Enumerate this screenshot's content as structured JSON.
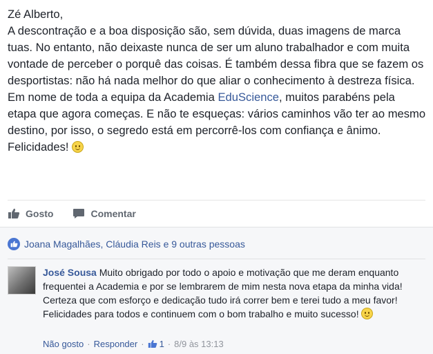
{
  "post": {
    "greeting": "Zé Alberto,",
    "paragraph1": "A descontração e a boa disposição são, sem dúvida, duas imagens de marca tuas. No entanto, não deixaste nunca de ser um aluno trabalhador e com muita vontade de perceber o porquê das coisas. É também dessa fibra que se fazem os desportistas: não há nada melhor do que aliar o conhecimento à destreza física.",
    "paragraph2_before": "Em nome de toda a equipa da Academia ",
    "paragraph2_link": "EduScience",
    "paragraph2_after": ", muitos parabéns pela etapa que agora começas. E não te esqueças: vários caminhos vão ter ao mesmo destino, por isso, o segredo está em percorrê-los com confiança e ânimo.",
    "closing": "Felicidades!"
  },
  "actions": {
    "like_label": "Gosto",
    "comment_label": "Comentar"
  },
  "likes": {
    "text": "Joana Magalhães, Cláudia Reis e 9 outras pessoas"
  },
  "comment": {
    "author": "José Sousa",
    "text1": " Muito obrigado por todo o apoio e motivação que me deram enquanto frequentei a Academia e por se lembrarem de mim nesta nova etapa da minha vida! Certeza que com esforço e dedicação tudo irá correr bem e terei tudo a meu favor!",
    "text2": "Felicidades para todos e continuem com o bom trabalho e muito sucesso!",
    "unlike_label": "Não gosto",
    "reply_label": "Responder",
    "separator": "·",
    "like_count": "1",
    "timestamp": "8/9 às 13:13"
  },
  "colors": {
    "link": "#365899",
    "text": "#1d2129",
    "muted": "#90949c",
    "comment_bg": "#f6f7f9"
  },
  "icons": [
    "smiley-icon",
    "thumbs-up-icon",
    "comment-icon",
    "like-badge-icon"
  ]
}
